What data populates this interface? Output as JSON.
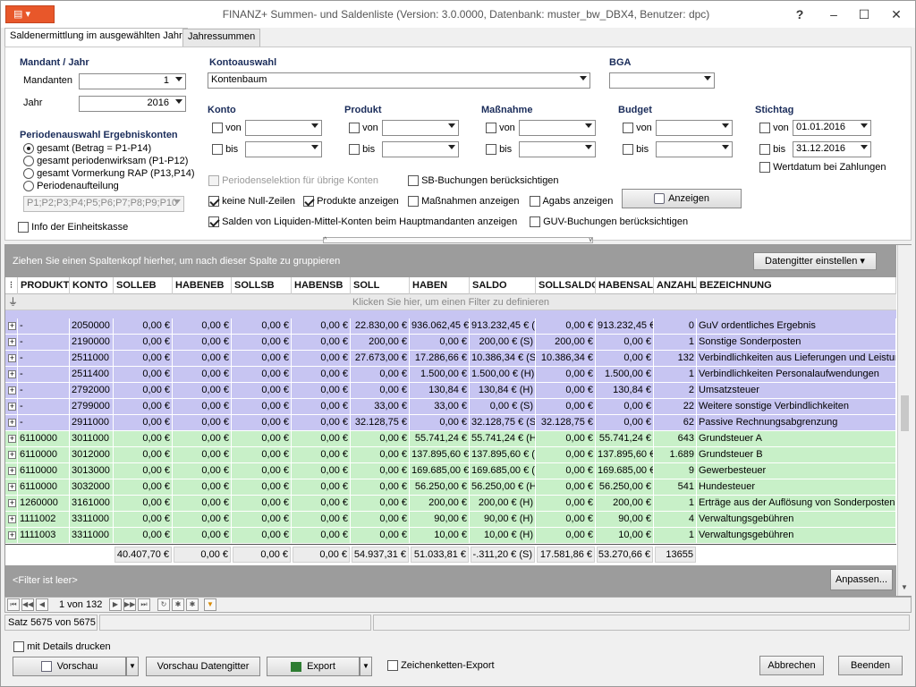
{
  "window": {
    "app_menu": "▤",
    "title": "FINANZ+ Summen- und Saldenliste (Version: 3.0.0000, Datenbank: muster_bw_DBX4, Benutzer: dpc)",
    "help": "?",
    "min": "–",
    "max": "☐",
    "close": "✕"
  },
  "tabs": [
    "Saldenermittlung im ausgewählten Jahr",
    "Jahressummen"
  ],
  "mandant": {
    "heading": "Mandant / Jahr",
    "mandanten_label": "Mandanten",
    "mandanten_value": "1",
    "jahr_label": "Jahr",
    "jahr_value": "2016"
  },
  "periode": {
    "heading": "Periodenauswahl Ergebniskonten",
    "options": [
      "gesamt (Betrag = P1-P14)",
      "gesamt periodenwirksam (P1-P12)",
      "gesamt Vormerkung RAP (P13,P14)",
      "Periodenaufteilung"
    ],
    "perioden_value": "P1;P2;P3;P4;P5;P6;P7;P8;P9;P10",
    "einheitskasse": "Info der Einheitskasse"
  },
  "kontoauswahl": {
    "heading": "Kontoauswahl",
    "value": "Kontenbaum"
  },
  "bga": {
    "heading": "BGA",
    "value": ""
  },
  "konto": {
    "heading": "Konto",
    "von": "von",
    "bis": "bis"
  },
  "produkt": {
    "heading": "Produkt",
    "von": "von",
    "bis": "bis"
  },
  "massnahme": {
    "heading": "Maßnahme",
    "von": "von",
    "bis": "bis"
  },
  "budget": {
    "heading": "Budget",
    "von": "von",
    "bis": "bis"
  },
  "stichtag": {
    "heading": "Stichtag",
    "von": "von",
    "von_value": "01.01.2016",
    "bis": "bis",
    "bis_value": "31.12.2016",
    "wertdatum": "Wertdatum bei Zahlungen"
  },
  "options": {
    "periodenselektion": "Periodenselektion für übrige Konten",
    "sb_buchungen": "SB-Buchungen  berücksichtigen",
    "keine_null": "keine Null-Zeilen",
    "produkte_anzeigen": "Produkte anzeigen",
    "massnahmen_anzeigen": "Maßnahmen anzeigen",
    "agabs": "Agabs  anzeigen",
    "anzeigen_button": "Anzeigen",
    "salden_liquide": "Salden von Liquiden-Mittel-Konten beim Hauptmandanten anzeigen",
    "guv_buchungen": "GUV-Buchungen  berücksichtigen"
  },
  "grid": {
    "group_hint": "Ziehen Sie einen Spaltenkopf hierher, um nach dieser Spalte zu gruppieren",
    "datengitter_button": "Datengitter einstellen",
    "columns": [
      "PRODUKT",
      "KONTO",
      "SOLLEB",
      "HABENEB",
      "SOLLSB",
      "HABENSB",
      "SOLL",
      "HABEN",
      "SALDO",
      "SOLLSALDO",
      "HABENSALDO",
      "ANZAHL",
      "BEZEICHNUNG"
    ],
    "filter_hint": "Klicken Sie hier, um einen Filter zu definieren",
    "rows": [
      {
        "color": "purple",
        "cells": [
          "-",
          "2050000",
          "0,00 €",
          "0,00 €",
          "0,00 €",
          "0,00 €",
          "22.830,00 €",
          "936.062,45 €",
          "913.232,45 € (H)",
          "0,00 €",
          "913.232,45 €",
          "0",
          "GuV ordentliches Ergebnis"
        ]
      },
      {
        "color": "purple",
        "cells": [
          "-",
          "2190000",
          "0,00 €",
          "0,00 €",
          "0,00 €",
          "0,00 €",
          "200,00 €",
          "0,00 €",
          "200,00 € (S)",
          "200,00 €",
          "0,00 €",
          "1",
          "Sonstige Sonderposten"
        ]
      },
      {
        "color": "purple",
        "cells": [
          "-",
          "2511000",
          "0,00 €",
          "0,00 €",
          "0,00 €",
          "0,00 €",
          "27.673,00 €",
          "17.286,66 €",
          "10.386,34 € (S)",
          "10.386,34 €",
          "0,00 €",
          "132",
          "Verbindlichkeiten aus Lieferungen und Leistungen"
        ]
      },
      {
        "color": "purple",
        "cells": [
          "-",
          "2511400",
          "0,00 €",
          "0,00 €",
          "0,00 €",
          "0,00 €",
          "0,00 €",
          "1.500,00 €",
          "1.500,00 € (H)",
          "0,00 €",
          "1.500,00 €",
          "1",
          "Verbindlichkeiten Personalaufwendungen"
        ]
      },
      {
        "color": "purple",
        "cells": [
          "-",
          "2792000",
          "0,00 €",
          "0,00 €",
          "0,00 €",
          "0,00 €",
          "0,00 €",
          "130,84 €",
          "130,84 € (H)",
          "0,00 €",
          "130,84 €",
          "2",
          "Umsatzsteuer"
        ]
      },
      {
        "color": "purple",
        "cells": [
          "-",
          "2799000",
          "0,00 €",
          "0,00 €",
          "0,00 €",
          "0,00 €",
          "33,00 €",
          "33,00 €",
          "0,00 € (S)",
          "0,00 €",
          "0,00 €",
          "22",
          "Weitere sonstige Verbindlichkeiten"
        ]
      },
      {
        "color": "purple",
        "cells": [
          "-",
          "2911000",
          "0,00 €",
          "0,00 €",
          "0,00 €",
          "0,00 €",
          "32.128,75 €",
          "0,00 €",
          "32.128,75 € (S)",
          "32.128,75 €",
          "0,00 €",
          "62",
          "Passive Rechnungsabgrenzung"
        ]
      },
      {
        "color": "green",
        "cells": [
          "6110000",
          "3011000",
          "0,00 €",
          "0,00 €",
          "0,00 €",
          "0,00 €",
          "0,00 €",
          "55.741,24 €",
          "55.741,24 € (H)",
          "0,00 €",
          "55.741,24 €",
          "643",
          "Grundsteuer A"
        ]
      },
      {
        "color": "green",
        "cells": [
          "6110000",
          "3012000",
          "0,00 €",
          "0,00 €",
          "0,00 €",
          "0,00 €",
          "0,00 €",
          "137.895,60 €",
          "137.895,60 € (H)",
          "0,00 €",
          "137.895,60 €",
          "1.689",
          "Grundsteuer B"
        ]
      },
      {
        "color": "green",
        "cells": [
          "6110000",
          "3013000",
          "0,00 €",
          "0,00 €",
          "0,00 €",
          "0,00 €",
          "0,00 €",
          "169.685,00 €",
          "169.685,00 € (H)",
          "0,00 €",
          "169.685,00 €",
          "9",
          "Gewerbesteuer"
        ]
      },
      {
        "color": "green",
        "cells": [
          "6110000",
          "3032000",
          "0,00 €",
          "0,00 €",
          "0,00 €",
          "0,00 €",
          "0,00 €",
          "56.250,00 €",
          "56.250,00 € (H)",
          "0,00 €",
          "56.250,00 €",
          "541",
          "Hundesteuer"
        ]
      },
      {
        "color": "green",
        "cells": [
          "1260000",
          "3161000",
          "0,00 €",
          "0,00 €",
          "0,00 €",
          "0,00 €",
          "0,00 €",
          "200,00 €",
          "200,00 € (H)",
          "0,00 €",
          "200,00 €",
          "1",
          "Erträge aus der Auflösung von Sonderposten"
        ]
      },
      {
        "color": "green",
        "cells": [
          "1111002",
          "3311000",
          "0,00 €",
          "0,00 €",
          "0,00 €",
          "0,00 €",
          "0,00 €",
          "90,00 €",
          "90,00 € (H)",
          "0,00 €",
          "90,00 €",
          "4",
          "Verwaltungsgebühren"
        ]
      },
      {
        "color": "green",
        "cells": [
          "1111003",
          "3311000",
          "0,00 €",
          "0,00 €",
          "0,00 €",
          "0,00 €",
          "0,00 €",
          "10,00 €",
          "10,00 € (H)",
          "0,00 €",
          "10,00 €",
          "1",
          "Verwaltungsgebühren"
        ]
      }
    ],
    "totals": [
      "40.407,70 €",
      "0,00 €",
      "0,00 €",
      "0,00 €",
      "54.937,31 €",
      "51.033,81 €",
      "-.311,20 € (S)",
      "17.581,86 €",
      "53.270,66 €",
      "13655"
    ],
    "filter_status": "<Filter ist leer>",
    "anpassen_button": "Anpassen..."
  },
  "nav": {
    "page": "1 von 132"
  },
  "status": {
    "record": "Satz 5675 von 5675"
  },
  "bottom": {
    "details_label": "mit  Details drucken",
    "vorschau": "Vorschau",
    "vorschau_datengitter": "Vorschau Datengitter",
    "export": "Export",
    "zeichenketten": "Zeichenketten-Export",
    "abbrechen": "Abbrechen",
    "beenden": "Beenden"
  }
}
